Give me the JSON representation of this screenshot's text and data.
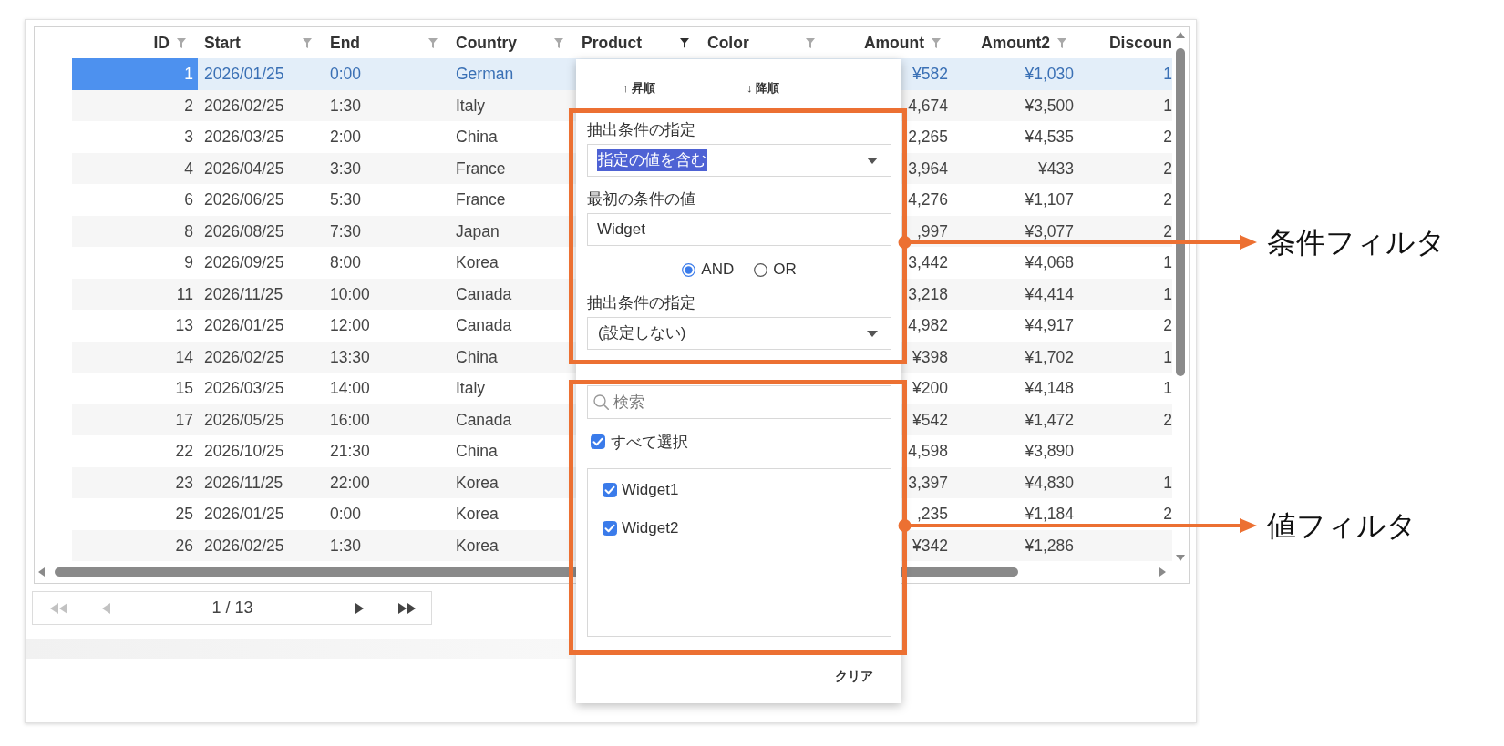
{
  "table": {
    "columns": [
      {
        "label": "ID",
        "kind": "number",
        "filtered": false
      },
      {
        "label": "Start",
        "kind": "text",
        "filtered": false
      },
      {
        "label": "End",
        "kind": "text",
        "filtered": false
      },
      {
        "label": "Country",
        "kind": "text",
        "filtered": false
      },
      {
        "label": "Product",
        "kind": "text",
        "filtered": true
      },
      {
        "label": "Color",
        "kind": "text",
        "filtered": false
      },
      {
        "label": "Amount",
        "kind": "number",
        "filtered": false
      },
      {
        "label": "Amount2",
        "kind": "number",
        "filtered": false
      },
      {
        "label": "Discoun",
        "kind": "number"
      }
    ],
    "rows": [
      {
        "selected": true,
        "id": "1",
        "start": "2026/01/25",
        "end": "0:00",
        "country": "German",
        "amount": "¥582",
        "amount2": "¥1,030",
        "discount": "1"
      },
      {
        "selected": false,
        "id": "2",
        "start": "2026/02/25",
        "end": "1:30",
        "country": "Italy",
        "amount": "4,674",
        "amount2": "¥3,500",
        "discount": "1"
      },
      {
        "selected": false,
        "id": "3",
        "start": "2026/03/25",
        "end": "2:00",
        "country": "China",
        "amount": "2,265",
        "amount2": "¥4,535",
        "discount": "2"
      },
      {
        "selected": false,
        "id": "4",
        "start": "2026/04/25",
        "end": "3:30",
        "country": "France",
        "amount": "3,964",
        "amount2": "¥433",
        "discount": "2"
      },
      {
        "selected": false,
        "id": "6",
        "start": "2026/06/25",
        "end": "5:30",
        "country": "France",
        "amount": "4,276",
        "amount2": "¥1,107",
        "discount": "2"
      },
      {
        "selected": false,
        "id": "8",
        "start": "2026/08/25",
        "end": "7:30",
        "country": "Japan",
        "amount": ",997",
        "amount2": "¥3,077",
        "discount": "2"
      },
      {
        "selected": false,
        "id": "9",
        "start": "2026/09/25",
        "end": "8:00",
        "country": "Korea",
        "amount": "3,442",
        "amount2": "¥4,068",
        "discount": "1"
      },
      {
        "selected": false,
        "id": "11",
        "start": "2026/11/25",
        "end": "10:00",
        "country": "Canada",
        "amount": "3,218",
        "amount2": "¥4,414",
        "discount": "1"
      },
      {
        "selected": false,
        "id": "13",
        "start": "2026/01/25",
        "end": "12:00",
        "country": "Canada",
        "amount": "4,982",
        "amount2": "¥4,917",
        "discount": "2"
      },
      {
        "selected": false,
        "id": "14",
        "start": "2026/02/25",
        "end": "13:30",
        "country": "China",
        "amount": "¥398",
        "amount2": "¥1,702",
        "discount": "1"
      },
      {
        "selected": false,
        "id": "15",
        "start": "2026/03/25",
        "end": "14:00",
        "country": "Italy",
        "amount": "¥200",
        "amount2": "¥4,148",
        "discount": "1"
      },
      {
        "selected": false,
        "id": "17",
        "start": "2026/05/25",
        "end": "16:00",
        "country": "Canada",
        "amount": "¥542",
        "amount2": "¥1,472",
        "discount": "2"
      },
      {
        "selected": false,
        "id": "22",
        "start": "2026/10/25",
        "end": "21:30",
        "country": "China",
        "amount": "4,598",
        "amount2": "¥3,890"
      },
      {
        "selected": false,
        "id": "23",
        "start": "2026/11/25",
        "end": "22:00",
        "country": "Korea",
        "amount": "3,397",
        "amount2": "¥4,830",
        "discount": "1"
      },
      {
        "selected": false,
        "id": "25",
        "start": "2026/01/25",
        "end": "0:00",
        "country": "Korea",
        "amount": ",235",
        "amount2": "¥1,184",
        "discount": "2"
      },
      {
        "selected": false,
        "id": "26",
        "start": "2026/02/25",
        "end": "1:30",
        "country": "Korea",
        "amount": "¥342",
        "amount2": "¥1,286"
      }
    ]
  },
  "pager": {
    "buttons": [
      {
        "kind": "first",
        "disabled": true
      },
      {
        "kind": "previous",
        "disabled": true
      },
      {
        "kind": "next",
        "disabled": false
      },
      {
        "kind": "last",
        "disabled": false
      }
    ],
    "page": "1 / 13"
  },
  "filter_popup": {
    "sort_buttons": [
      "↑ 昇順",
      "↓ 降順"
    ],
    "condition_filter": {
      "fields": [
        {
          "kind": "dropdown",
          "label": "抽出条件の指定",
          "value": "指定の値を含む",
          "highlighted": true
        },
        {
          "kind": "text",
          "label": "最初の条件の値",
          "value": "Widget"
        },
        {
          "kind": "radios",
          "options": [
            {
              "label": "AND",
              "selected": true
            },
            {
              "label": "OR",
              "selected": false
            }
          ]
        },
        {
          "kind": "dropdown",
          "label": "抽出条件の指定",
          "value": "(設定しない)",
          "highlighted": false
        }
      ]
    },
    "value_filter": {
      "search_placeholder": "検索",
      "select_all": {
        "label": "すべて選択",
        "checked": true
      },
      "items": [
        {
          "label": "Widget1",
          "checked": true
        },
        {
          "label": "Widget2",
          "checked": true
        }
      ]
    },
    "clear_button": "クリア"
  },
  "callouts": [
    {
      "label": "条件フィルタ"
    },
    {
      "label": "値フィルタ"
    }
  ]
}
